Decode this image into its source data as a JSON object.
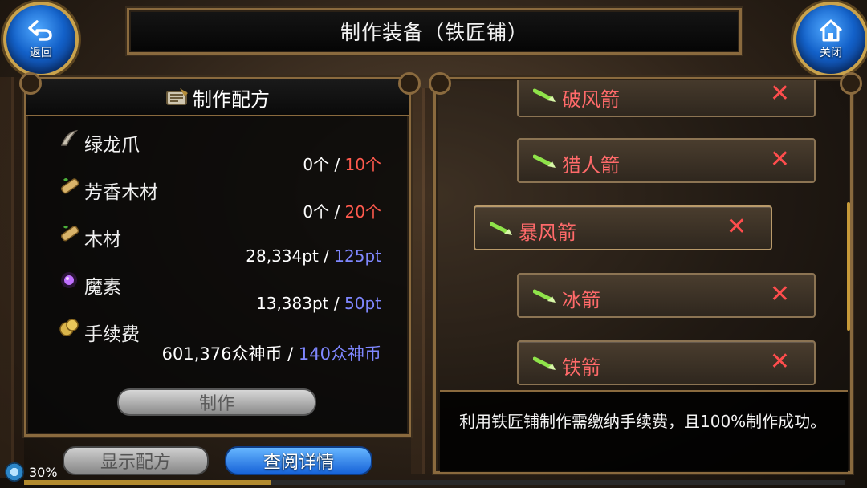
{
  "header": {
    "title": "制作装备（铁匠铺）"
  },
  "nav": {
    "back": {
      "label": "返回",
      "icon": "back-arrow-icon"
    },
    "close": {
      "label": "关闭",
      "icon": "home-icon"
    }
  },
  "recipe_panel": {
    "title": "制作配方",
    "icon": "recipe-book-icon",
    "materials": [
      {
        "name": "绿龙爪",
        "icon": "claw-icon",
        "have": "0个",
        "need": "10个"
      },
      {
        "name": "芳香木材",
        "icon": "wood-icon",
        "have": "0个",
        "need": "20个"
      },
      {
        "name": "木材",
        "icon": "wood-icon",
        "have": "28,334pt",
        "need": "125pt"
      },
      {
        "name": "魔素",
        "icon": "magic-orb-icon",
        "have": "13,383pt",
        "need": "50pt"
      },
      {
        "name": "手续费",
        "icon": "coin-icon",
        "have": "601,376众神币",
        "need": "140众神币"
      }
    ],
    "separator": "/",
    "craft_button": "制作"
  },
  "bottom_buttons": {
    "show_recipe": "显示配方",
    "view_details": "查阅详情"
  },
  "recipe_list": {
    "items": [
      {
        "name": "破风箭",
        "selected": false
      },
      {
        "name": "猎人箭",
        "selected": false
      },
      {
        "name": "暴风箭",
        "selected": true
      },
      {
        "name": "冰箭",
        "selected": false
      },
      {
        "name": "铁箭",
        "selected": false
      }
    ]
  },
  "info_text": "利用铁匠铺制作需缴纳手续费，且100%制作成功。",
  "status": {
    "progress_percent": 30,
    "progress_label": "30%",
    "bar_fill": 0.3
  },
  "colors": {
    "need_red": "#ff5a4e",
    "need_blue": "#7f87ff",
    "recipe_name": "#ff6a6a",
    "frame_gold": "#8a6a3e"
  }
}
